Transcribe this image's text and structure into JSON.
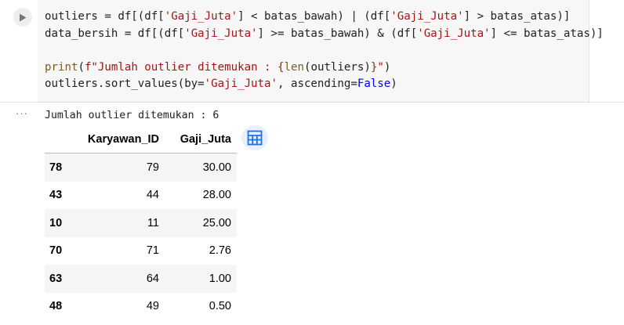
{
  "code_lines": [
    [
      [
        "outliers = df[(df[",
        ""
      ],
      [
        "'Gaji_Juta'",
        "str"
      ],
      [
        "] < batas_bawah) | (df[",
        ""
      ],
      [
        "'Gaji_Juta'",
        "str"
      ],
      [
        "] > batas_atas)]",
        ""
      ]
    ],
    [
      [
        "data_bersih = df[(df[",
        ""
      ],
      [
        "'Gaji_Juta'",
        "str"
      ],
      [
        "] >= batas_bawah) & (df[",
        ""
      ],
      [
        "'Gaji_Juta'",
        "str"
      ],
      [
        "] <= batas_atas)]",
        ""
      ]
    ],
    [
      [
        "",
        ""
      ]
    ],
    [
      [
        "print",
        "fn"
      ],
      [
        "(",
        ""
      ],
      [
        "f\"Jumlah outlier ditemukan : ",
        "str"
      ],
      [
        "{",
        "br3"
      ],
      [
        "len",
        "fn"
      ],
      [
        "(outliers)",
        ""
      ],
      [
        "}",
        "br3"
      ],
      [
        "\"",
        "str"
      ],
      [
        ")",
        ""
      ]
    ],
    [
      [
        "outliers.sort_values(by=",
        ""
      ],
      [
        "'Gaji_Juta'",
        "str"
      ],
      [
        ", ascending=",
        ""
      ],
      [
        "False",
        "kw"
      ],
      [
        ")",
        ""
      ]
    ]
  ],
  "output": {
    "text": "Jumlah outlier ditemukan : 6",
    "table": {
      "columns": [
        "",
        "Karyawan_ID",
        "Gaji_Juta"
      ],
      "rows": [
        [
          "78",
          "79",
          "30.00"
        ],
        [
          "43",
          "44",
          "28.00"
        ],
        [
          "10",
          "11",
          "25.00"
        ],
        [
          "70",
          "71",
          "2.76"
        ],
        [
          "63",
          "64",
          "1.00"
        ],
        [
          "48",
          "49",
          "0.50"
        ]
      ]
    }
  },
  "icons": {
    "run": "play-icon",
    "output_menu": "more-horizontal-icon",
    "table_view": "table-icon"
  },
  "colors": {
    "string": "#a31515",
    "keyword": "#0000ff",
    "function": "#795e26",
    "table_button_bg": "#e8f0fe",
    "table_icon": "#1a73e8"
  }
}
